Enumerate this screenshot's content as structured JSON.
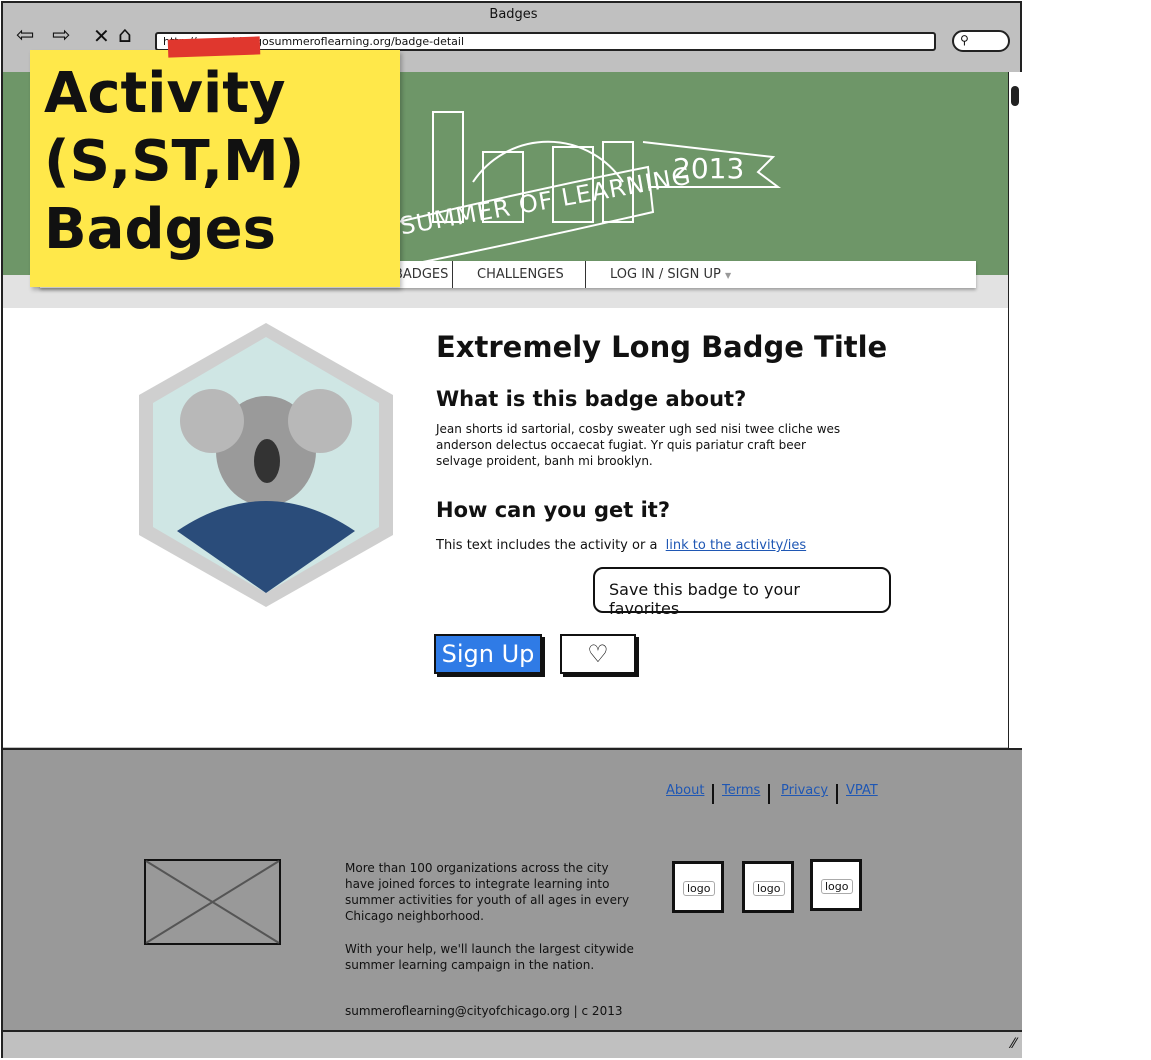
{
  "browser": {
    "title": "Badges",
    "url": "http://www.chicagosummeroflearning.org/badge-detail",
    "icons": [
      "back-arrow-icon",
      "forward-arrow-icon",
      "close-icon",
      "home-icon",
      "search-icon"
    ]
  },
  "banner": {
    "logo_text": "SUMMER OF LEARNING",
    "year": "2013",
    "bg_color": "#6e9668"
  },
  "nav": {
    "items": [
      "BADGES",
      "CHALLENGES",
      "LOG IN / SIGN UP"
    ]
  },
  "sticky": {
    "lines": [
      "Activity",
      "(S,ST,M)",
      "Badges"
    ]
  },
  "badge": {
    "title": "Extremely Long Badge Title",
    "about_heading": "What is this badge about?",
    "about_text": "Jean shorts id sartorial, cosby sweater ugh sed nisi twee cliche wes anderson delectus occaecat fugiat. Yr quis pariatur craft beer selvage proident, banh mi brooklyn.",
    "get_heading": "How can you get it?",
    "get_text": "This text includes the activity or a",
    "get_link": "link to the activity/ies",
    "signup_label": "Sign Up",
    "tooltip": "Save this badge to your favorites",
    "accent": "#2f7be6"
  },
  "footer": {
    "links": [
      "About",
      "Terms",
      "Privacy",
      "VPAT"
    ],
    "para1": "More than 100 organizations across the city have joined forces to integrate learning into summer activities for youth of all ages in every Chicago neighborhood.",
    "para2": "With your help, we'll launch the largest citywide summer learning campaign in the nation.",
    "contact": "summeroflearning@cityofchicago.org | c 2013",
    "logo_label": "logo"
  }
}
